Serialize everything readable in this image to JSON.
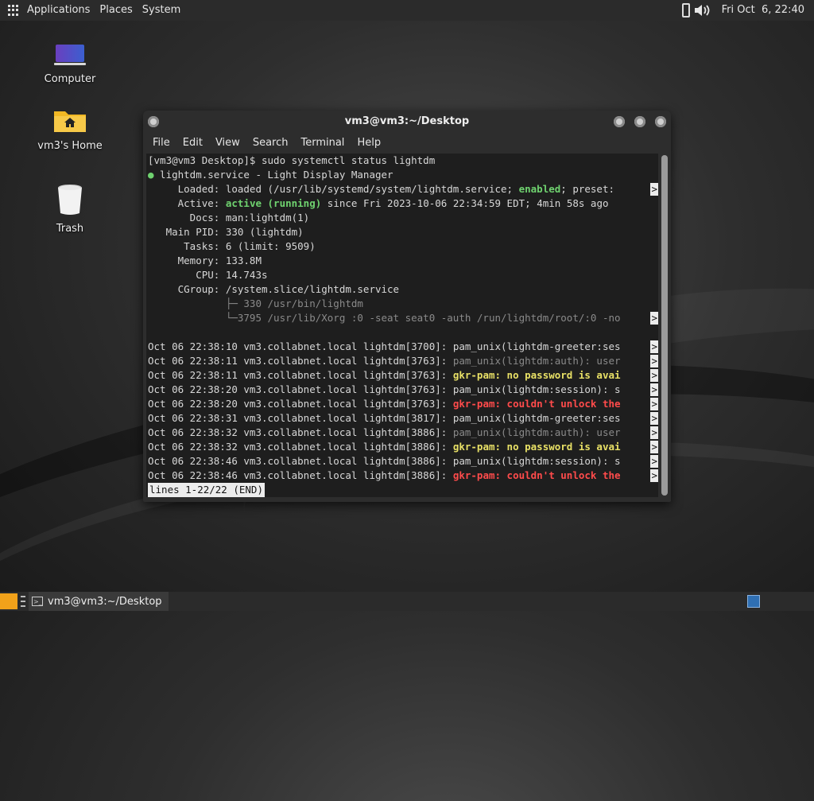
{
  "top_panel": {
    "applications": "Applications",
    "places": "Places",
    "system": "System",
    "clock": "Fri Oct  6, 22:40"
  },
  "desktop": {
    "icons": [
      {
        "label": "Computer",
        "icon": "computer-icon"
      },
      {
        "label": "vm3's Home",
        "icon": "home-folder-icon"
      },
      {
        "label": "Trash",
        "icon": "trash-icon"
      }
    ]
  },
  "terminal": {
    "title": "vm3@vm3:~/Desktop",
    "menu": [
      "File",
      "Edit",
      "View",
      "Search",
      "Terminal",
      "Help"
    ],
    "lines": {
      "l01": "[vm3@vm3 Desktop]$ sudo systemctl status lightdm",
      "l02_dot": "●",
      "l02": " lightdm.service - Light Display Manager",
      "l03a": "     Loaded: loaded (/usr/lib/systemd/system/lightdm.service; ",
      "l03b": "enabled",
      "l03c": "; preset: ",
      "l04a": "     Active: ",
      "l04b": "active (running)",
      "l04c": " since Fri 2023-10-06 22:34:59 EDT; 4min 58s ago",
      "l05": "       Docs: man:lightdm(1)",
      "l06": "   Main PID: 330 (lightdm)",
      "l07": "      Tasks: 6 (limit: 9509)",
      "l08": "     Memory: 133.8M",
      "l09": "        CPU: 14.743s",
      "l10": "     CGroup: /system.slice/lightdm.service",
      "l11": "             ├─ 330 /usr/bin/lightdm",
      "l12": "             └─3795 /usr/lib/Xorg :0 -seat seat0 -auth /run/lightdm/root/:0 -no",
      "log_prefix_3700": "Oct 06 22:38:10 vm3.collabnet.local lightdm[3700]: ",
      "log01": "pam_unix(lightdm-greeter:ses",
      "log_prefix_3763a": "Oct 06 22:38:11 vm3.collabnet.local lightdm[3763]: ",
      "log02": "pam_unix(lightdm:auth): user",
      "log_prefix_3763b": "Oct 06 22:38:11 vm3.collabnet.local lightdm[3763]: ",
      "log03": "gkr-pam: no password is avai",
      "log_prefix_3763c": "Oct 06 22:38:20 vm3.collabnet.local lightdm[3763]: ",
      "log04": "pam_unix(lightdm:session): s",
      "log_prefix_3763d": "Oct 06 22:38:20 vm3.collabnet.local lightdm[3763]: ",
      "log05": "gkr-pam: couldn't unlock the",
      "log_prefix_3817": "Oct 06 22:38:31 vm3.collabnet.local lightdm[3817]: ",
      "log06": "pam_unix(lightdm-greeter:ses",
      "log_prefix_3886a": "Oct 06 22:38:32 vm3.collabnet.local lightdm[3886]: ",
      "log07": "pam_unix(lightdm:auth): user",
      "log_prefix_3886b": "Oct 06 22:38:32 vm3.collabnet.local lightdm[3886]: ",
      "log08": "gkr-pam: no password is avai",
      "log_prefix_3886c": "Oct 06 22:38:46 vm3.collabnet.local lightdm[3886]: ",
      "log09": "pam_unix(lightdm:session): s",
      "log_prefix_3886d": "Oct 06 22:38:46 vm3.collabnet.local lightdm[3886]: ",
      "log10": "gkr-pam: couldn't unlock the",
      "truncation_marker": ">",
      "pager_status": "lines 1-22/22 (END)"
    }
  },
  "bottom_panel": {
    "task_label": "vm3@vm3:~/Desktop"
  },
  "colors": {
    "panel_bg": "#2b2b2b",
    "terminal_bg": "#1e1e1e",
    "green": "#6fd26f",
    "yellow": "#e8e066",
    "red": "#ff4b4b",
    "workspace_blue": "#2f6fb3"
  }
}
